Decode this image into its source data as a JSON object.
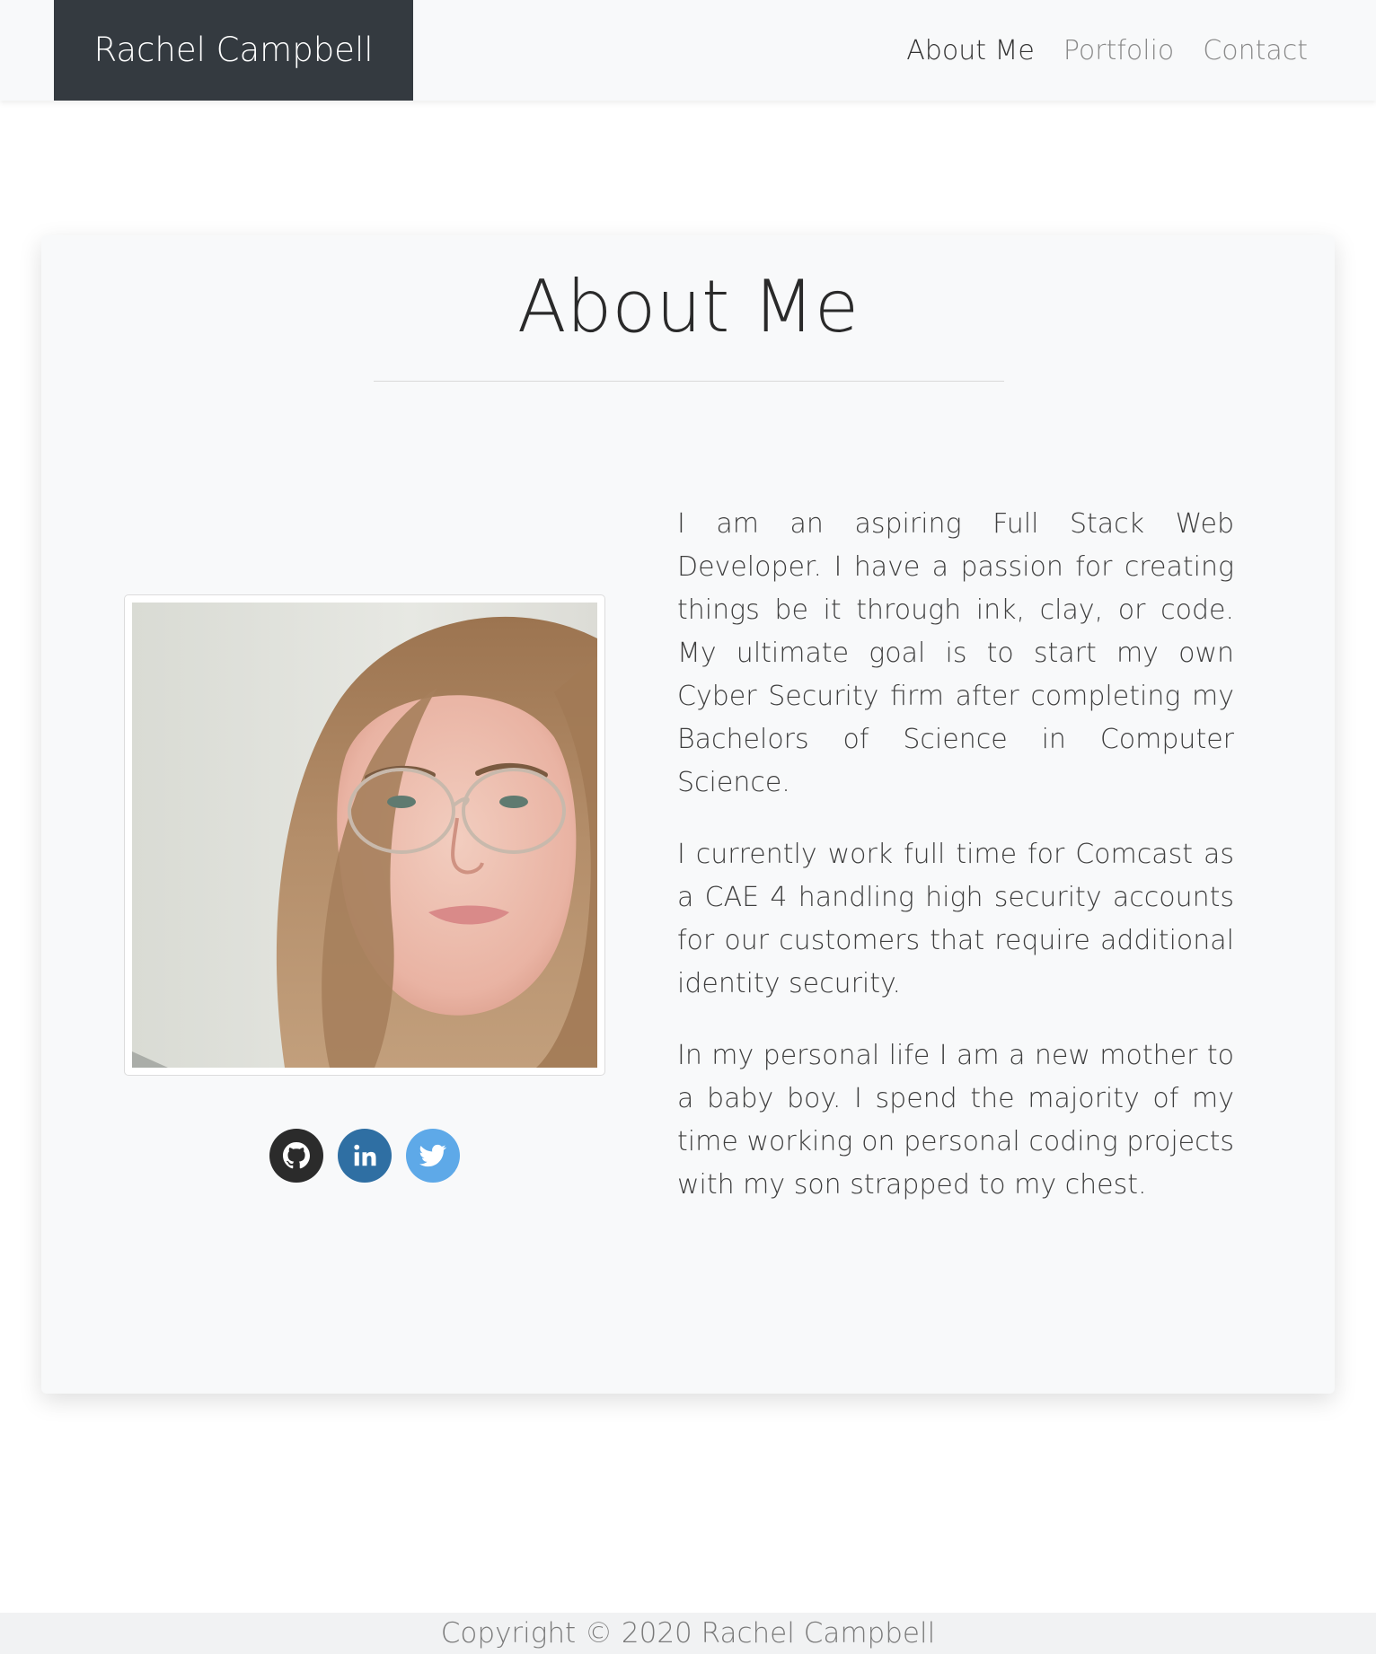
{
  "navbar": {
    "brand": "Rachel Campbell",
    "links": [
      {
        "label": "About Me",
        "active": true
      },
      {
        "label": "Portfolio",
        "active": false
      },
      {
        "label": "Contact",
        "active": false
      }
    ]
  },
  "about": {
    "title": "About Me",
    "photo_icon": "portrait-photo",
    "paragraphs": [
      "I am an aspiring Full Stack Web Developer. I have a passion for creating things be it through ink, clay, or code. My ultimate goal is to start my own Cyber Security firm after completing my Bachelors of Science in Computer Science.",
      "I currently work full time for Comcast as a CAE 4 handling high security accounts for our customers that require additional identity security.",
      "In my personal life I am a new mother to a baby boy. I spend the majority of my time working on personal coding projects with my son strapped to my chest."
    ],
    "socials": [
      {
        "icon": "github-icon",
        "color": "#2b2b2b"
      },
      {
        "icon": "linkedin-icon",
        "color": "#2f6fa3"
      },
      {
        "icon": "twitter-icon",
        "color": "#5ea9e8"
      }
    ]
  },
  "footer": {
    "copyright": "Copyright © 2020 Rachel Campbell"
  },
  "colors": {
    "navbar_bg": "#f8f9fa",
    "brand_bg": "#343a40",
    "card_bg": "#f8f9fa",
    "footer_bg": "#f1f2f3"
  }
}
